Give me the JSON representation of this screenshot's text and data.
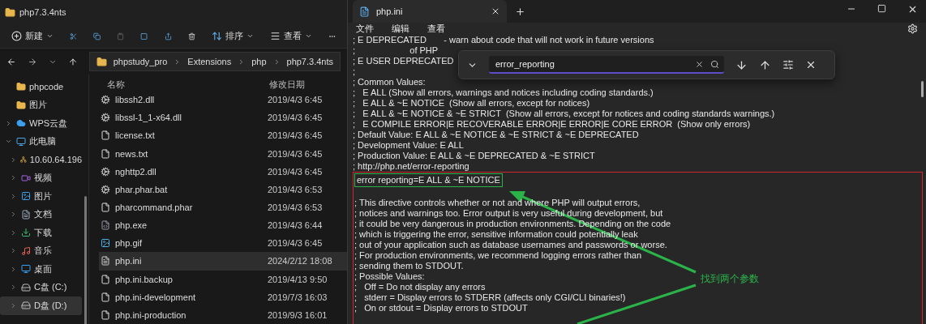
{
  "explorer": {
    "title": "php7.3.4nts",
    "toolbar": {
      "new_label": "新建",
      "sort_label": "排序",
      "view_label": "查看"
    },
    "breadcrumb": [
      "phpstudy_pro",
      "Extensions",
      "php",
      "php7.3.4nts"
    ],
    "sidebar": [
      {
        "label": "phpcode",
        "kind": "folder",
        "selected": false
      },
      {
        "label": "图片",
        "kind": "folder",
        "selected": false
      },
      {
        "label": "WPS云盘",
        "kind": "cloud",
        "expanded": false,
        "selected": false
      },
      {
        "label": "此电脑",
        "kind": "pc",
        "expanded": true,
        "selected": false,
        "children": [
          {
            "label": "10.60.64.196",
            "kind": "network",
            "expanded": false,
            "selected": false
          },
          {
            "label": "视频",
            "kind": "video",
            "expanded": false,
            "selected": false
          },
          {
            "label": "图片",
            "kind": "image",
            "expanded": false,
            "selected": false
          },
          {
            "label": "文档",
            "kind": "doc",
            "expanded": false,
            "selected": false
          },
          {
            "label": "下载",
            "kind": "download",
            "expanded": false,
            "selected": false
          },
          {
            "label": "音乐",
            "kind": "music",
            "expanded": false,
            "selected": false
          },
          {
            "label": "桌面",
            "kind": "desktop",
            "expanded": false,
            "selected": false
          },
          {
            "label": "C盘 (C:)",
            "kind": "drive",
            "expanded": false,
            "selected": false
          },
          {
            "label": "D盘 (D:)",
            "kind": "drive",
            "expanded": false,
            "selected": true
          }
        ]
      }
    ],
    "columns": [
      "名称",
      "修改日期"
    ],
    "files": [
      {
        "name": "libssh2.dll",
        "modified": "2019/4/3 6:45",
        "kind": "dll",
        "selected": false
      },
      {
        "name": "libssl-1_1-x64.dll",
        "modified": "2019/4/3 6:45",
        "kind": "dll",
        "selected": false
      },
      {
        "name": "license.txt",
        "modified": "2019/4/3 6:45",
        "kind": "text",
        "selected": false
      },
      {
        "name": "news.txt",
        "modified": "2019/4/3 6:45",
        "kind": "text",
        "selected": false
      },
      {
        "name": "nghttp2.dll",
        "modified": "2019/4/3 6:45",
        "kind": "dll",
        "selected": false
      },
      {
        "name": "phar.phar.bat",
        "modified": "2019/4/3 6:53",
        "kind": "dll",
        "selected": false
      },
      {
        "name": "pharcommand.phar",
        "modified": "2019/4/3 6:53",
        "kind": "text",
        "selected": false
      },
      {
        "name": "php.exe",
        "modified": "2019/4/3 6:44",
        "kind": "exe",
        "selected": false
      },
      {
        "name": "php.gif",
        "modified": "2019/4/3 6:45",
        "kind": "image",
        "selected": false
      },
      {
        "name": "php.ini",
        "modified": "2024/2/12 18:08",
        "kind": "ini",
        "selected": true
      },
      {
        "name": "php.ini.backup",
        "modified": "2019/4/13 9:50",
        "kind": "text",
        "selected": false
      },
      {
        "name": "php.ini-development",
        "modified": "2019/7/3 16:03",
        "kind": "text",
        "selected": false
      },
      {
        "name": "php.ini-production",
        "modified": "2019/9/3 16:01",
        "kind": "text",
        "selected": false
      }
    ]
  },
  "notepad": {
    "tab_title": "php.ini",
    "menu": [
      "文件",
      "编辑",
      "查看"
    ],
    "find": {
      "value": "error_reporting"
    },
    "lines": [
      "; E DEPRECATED       - warn about code that will not work in future versions",
      ";                      of PHP",
      "; E USER DEPRECATED",
      ";",
      "; Common Values:",
      ";   E ALL (Show all errors, warnings and notices including coding standards.)",
      ";   E ALL & ~E NOTICE  (Show all errors, except for notices)",
      ";   E ALL & ~E NOTICE & ~E STRICT  (Show all errors, except for notices and coding standards warnings.)",
      ";   E COMPILE ERROR|E RECOVERABLE ERROR|E ERROR|E CORE ERROR  (Show only errors)",
      "; Default Value: E ALL & ~E NOTICE & ~E STRICT & ~E DEPRECATED",
      "; Development Value: E ALL",
      "; Production Value: E ALL & ~E DEPRECATED & ~E STRICT",
      "; http://php.net/error-reporting"
    ],
    "marked_block": {
      "match_line": "error reporting=E ALL & ~E NOTICE",
      "lines": [
        "; This directive controls whether or not and where PHP will output errors,",
        "; notices and warnings too. Error output is very useful during development, but",
        "; it could be very dangerous in production environments. Depending on the code",
        "; which is triggering the error, sensitive information could potentially leak",
        "; out of your application such as database usernames and passwords or worse.",
        "; For production environments, we recommend logging errors rather than",
        "; sending them to STDOUT.",
        "; Possible Values:",
        ";   Off = Do not display any errors",
        ";   stderr = Display errors to STDERR (affects only CGI/CLI binaries!)",
        ";   On or stdout = Display errors to STDOUT"
      ]
    }
  },
  "annotation": {
    "text": "找到两个参数"
  }
}
